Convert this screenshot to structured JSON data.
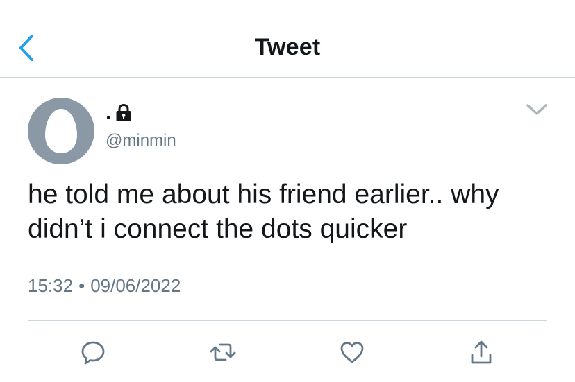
{
  "header": {
    "back_icon": "chevron-left-icon",
    "title": "Tweet"
  },
  "tweet": {
    "avatar_icon": "default-egg-avatar",
    "display_name": ".",
    "protected_icon": "lock-icon",
    "username": "@minmin",
    "menu_icon": "chevron-down-icon",
    "text": "he told me about his friend earlier.. why\ndidn’t i connect the dots quicker",
    "time": "15:32",
    "separator": "•",
    "date": "09/06/2022"
  },
  "actions": [
    {
      "icon": "reply-icon"
    },
    {
      "icon": "retweet-icon"
    },
    {
      "icon": "like-icon"
    },
    {
      "icon": "share-icon"
    }
  ],
  "colors": {
    "accent": "#1da1f2",
    "text": "#14171a",
    "secondary": "#657786",
    "avatar_bg": "#8b98a6",
    "divider": "#ced5db"
  }
}
